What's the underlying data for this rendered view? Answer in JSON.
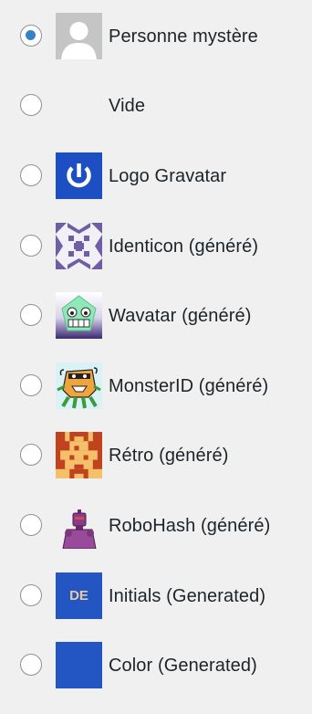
{
  "options": [
    {
      "label": "Personne mystère",
      "icon": "mystery-person-icon",
      "checked": true
    },
    {
      "label": "Vide",
      "icon": "blank-icon",
      "checked": false
    },
    {
      "label": "Logo Gravatar",
      "icon": "gravatar-logo-icon",
      "checked": false
    },
    {
      "label": "Identicon (généré)",
      "icon": "identicon-icon",
      "checked": false
    },
    {
      "label": "Wavatar (généré)",
      "icon": "wavatar-icon",
      "checked": false
    },
    {
      "label": "MonsterID (généré)",
      "icon": "monsterid-icon",
      "checked": false
    },
    {
      "label": "Rétro (généré)",
      "icon": "retro-icon",
      "checked": false
    },
    {
      "label": "RoboHash (généré)",
      "icon": "robohash-icon",
      "checked": false
    },
    {
      "label": "Initials (Generated)",
      "icon": "initials-icon",
      "initials": "DE",
      "checked": false
    },
    {
      "label": "Color (Generated)",
      "icon": "color-icon",
      "checked": false
    }
  ],
  "colors": {
    "radio_checked": "#3582c4",
    "gravatar_blue": "#1d4fc4",
    "identicon_purple": "#6f5ea3",
    "initials_bg": "#2356c2",
    "color_bg": "#2356c2"
  }
}
